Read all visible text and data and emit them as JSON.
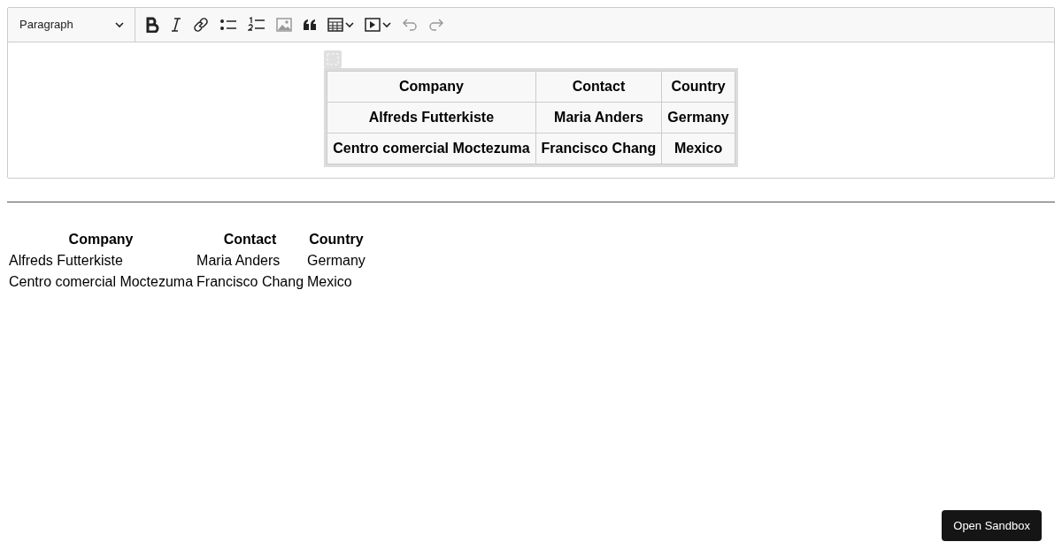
{
  "editor": {
    "toolbar": {
      "block_format": "Paragraph",
      "buttons": [
        {
          "kind": "bold",
          "disabled": false
        },
        {
          "kind": "italic",
          "disabled": false
        },
        {
          "kind": "link",
          "disabled": false
        },
        {
          "kind": "bullet-list",
          "disabled": false
        },
        {
          "kind": "numbered-list",
          "disabled": false
        },
        {
          "kind": "image",
          "disabled": true
        },
        {
          "kind": "quote",
          "disabled": false
        },
        {
          "kind": "table",
          "disabled": false
        },
        {
          "kind": "media",
          "disabled": false
        },
        {
          "kind": "undo",
          "disabled": true
        },
        {
          "kind": "redo",
          "disabled": true
        }
      ]
    },
    "table": {
      "columns": [
        "Company",
        "Contact",
        "Country"
      ],
      "rows": [
        [
          "Alfreds Futterkiste",
          "Maria Anders",
          "Germany"
        ],
        [
          "Centro comercial Moctezuma",
          "Francisco Chang",
          "Mexico"
        ]
      ]
    }
  },
  "preview": {
    "columns": [
      "Company",
      "Contact",
      "Country"
    ],
    "rows": [
      [
        "Alfreds Futterkiste",
        "Maria Anders",
        "Germany"
      ],
      [
        "Centro comercial Moctezuma",
        "Francisco Chang",
        "Mexico"
      ]
    ]
  },
  "sandbox_button": "Open Sandbox"
}
